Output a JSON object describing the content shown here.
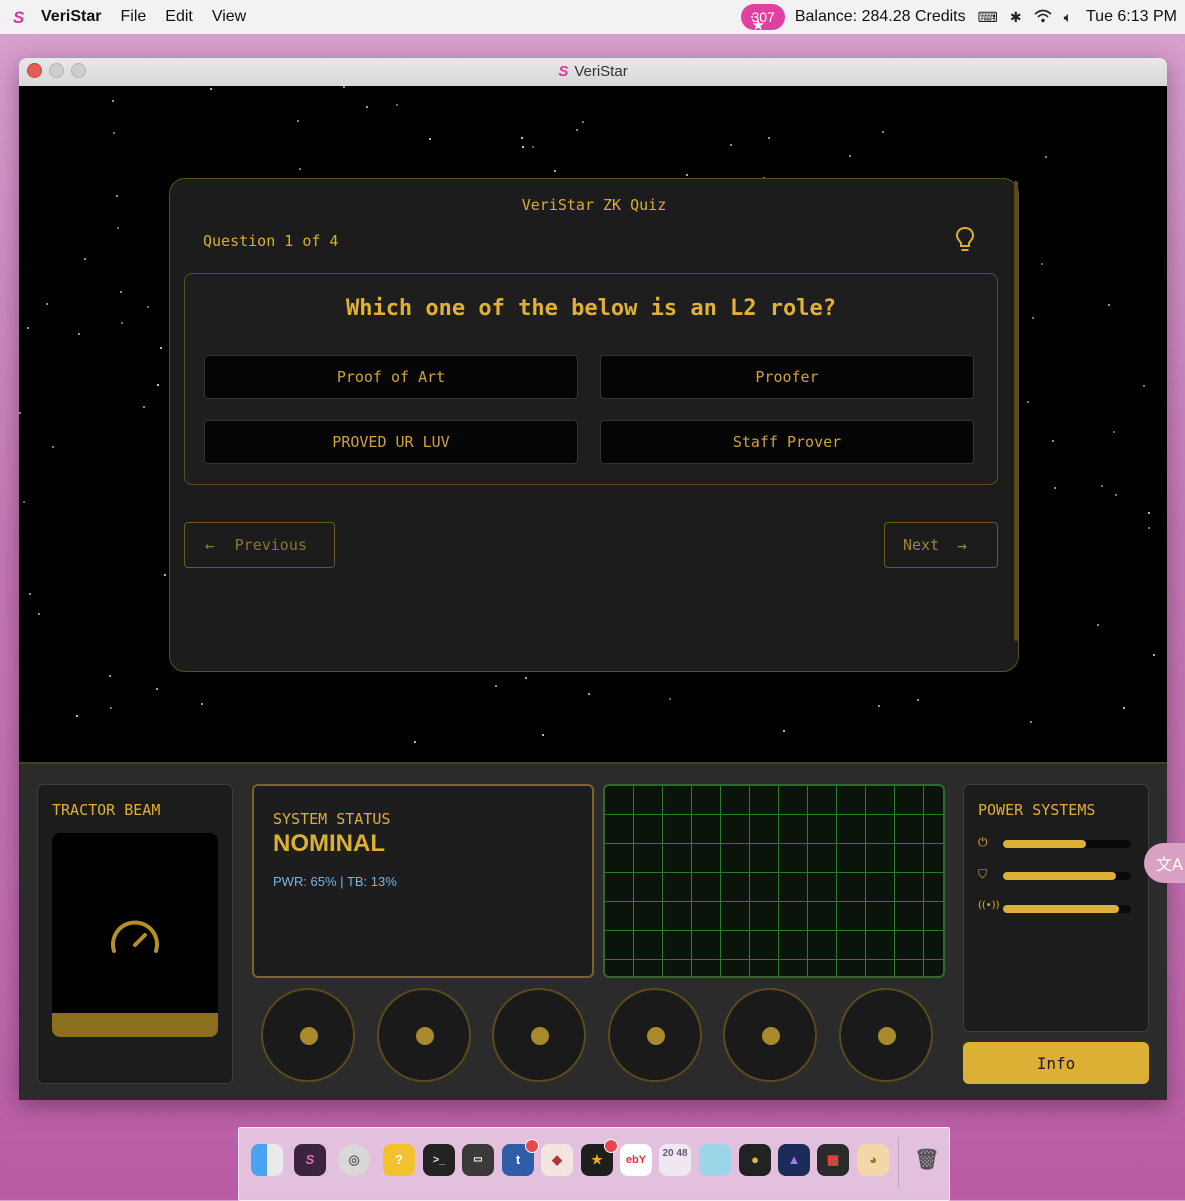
{
  "menubar": {
    "app_name": "VeriStar",
    "menus": [
      "File",
      "Edit",
      "View"
    ],
    "stars": "307",
    "balance_label": "Balance:",
    "balance_value": "284.28 Credits",
    "clock": "Tue 6:13 PM"
  },
  "window": {
    "title": "VeriStar"
  },
  "quiz": {
    "title": "VeriStar ZK Quiz",
    "progress": "Question 1 of 4",
    "question": "Which one of the below is an L2 role?",
    "answers": [
      "Proof of Art",
      "Proofer",
      "PROVED UR LUV",
      "Staff Prover"
    ],
    "prev_label": "Previous",
    "next_label": "Next"
  },
  "dashboard": {
    "tractor_beam_label": "TRACTOR BEAM",
    "status_heading": "SYSTEM STATUS",
    "status_value": "NOMINAL",
    "status_detail": "PWR: 65% | TB: 13%",
    "power_label": "POWER SYSTEMS",
    "power_levels": [
      0.65,
      0.88,
      0.91
    ],
    "info_label": "Info"
  },
  "colors": {
    "accent": "#dcb035",
    "brand": "#d6389a",
    "grid": "#2d7a30",
    "status_detail": "#7ab3e0"
  },
  "dock": {
    "icons": [
      "finder-icon",
      "veristar-icon",
      "globe-icon",
      "question-app-icon",
      "terminal-icon",
      "server-icon",
      "tumblr-icon",
      "wine-icon",
      "game-icon",
      "ebay-icon",
      "2048-icon",
      "pixel-art-icon",
      "coin-app-icon",
      "monster-icon",
      "calculator-icon",
      "cat-icon",
      "trash-icon"
    ],
    "tile_2048": "20 48"
  }
}
